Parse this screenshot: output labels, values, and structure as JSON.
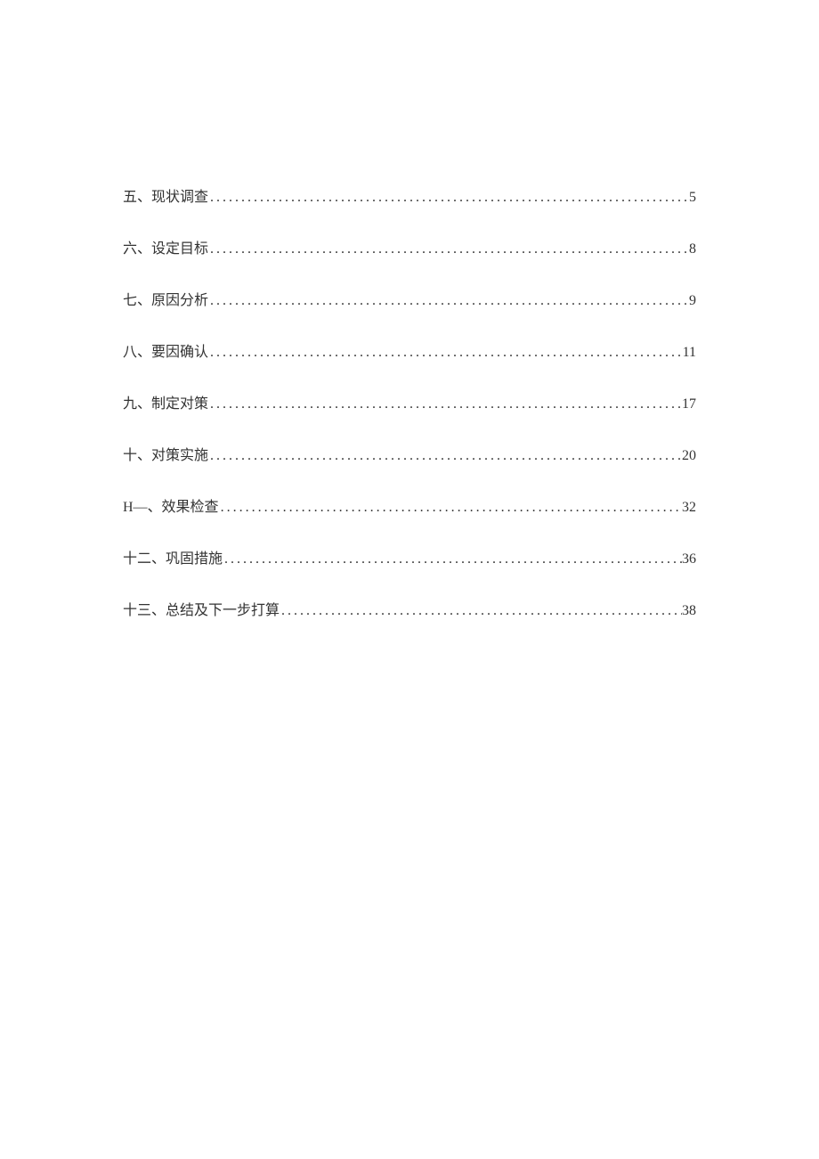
{
  "toc": {
    "entries": [
      {
        "label": "五、现状调查",
        "page": "5"
      },
      {
        "label": "六、设定目标",
        "page": "8"
      },
      {
        "label": "七、原因分析",
        "page": "9"
      },
      {
        "label": "八、要因确认",
        "page": "11"
      },
      {
        "label": "九、制定对策",
        "page": "17"
      },
      {
        "label": "十、对策实施",
        "page": "20"
      },
      {
        "label": "H—、效果检查",
        "page": "32"
      },
      {
        "label": "十二、巩固措施",
        "page": "36"
      },
      {
        "label": "十三、总结及下一步打算",
        "page": "38"
      }
    ]
  }
}
